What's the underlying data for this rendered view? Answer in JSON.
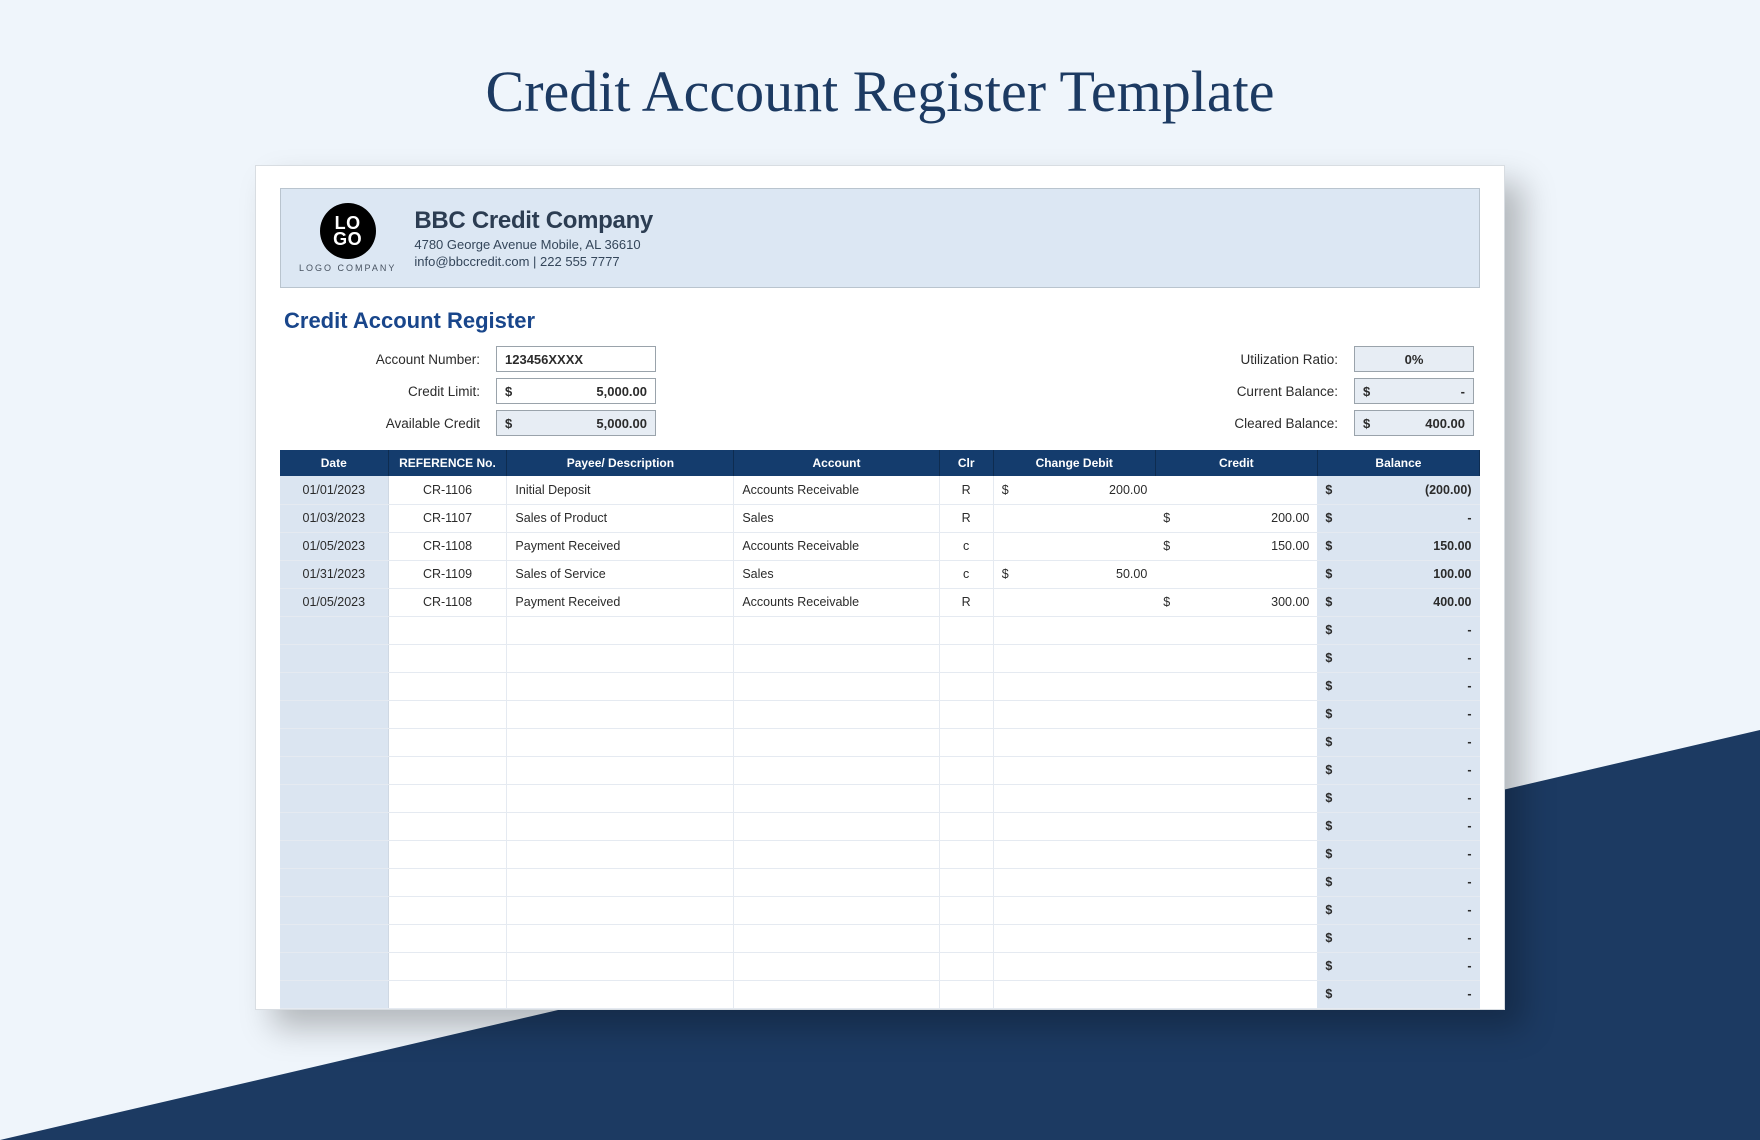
{
  "page": {
    "title": "Credit Account Register Template"
  },
  "logo": {
    "line1": "LO",
    "line2": "GO",
    "caption": "LOGO COMPANY"
  },
  "company": {
    "name": "BBC Credit Company",
    "address": "4780 George Avenue Mobile, AL 36610",
    "contact": "info@bbccredit.com | 222 555 7777"
  },
  "section_title": "Credit Account Register",
  "summary": {
    "left": [
      {
        "label": "Account Number:",
        "value": "123456XXXX",
        "shade": false,
        "style": "text"
      },
      {
        "label": "Credit Limit:",
        "value": "5,000.00",
        "shade": false,
        "style": "money"
      },
      {
        "label": "Available Credit",
        "value": "5,000.00",
        "shade": true,
        "style": "money"
      }
    ],
    "right": [
      {
        "label": "Utilization Ratio:",
        "value": "0%",
        "shade": true,
        "style": "center"
      },
      {
        "label": "Current Balance:",
        "value": "-",
        "shade": true,
        "style": "money"
      },
      {
        "label": "Cleared Balance:",
        "value": "400.00",
        "shade": true,
        "style": "money"
      }
    ]
  },
  "table": {
    "headers": [
      "Date",
      "REFERENCE No.",
      "Payee/ Description",
      "Account",
      "Clr",
      "Change Debit",
      "Credit",
      "Balance"
    ],
    "rows": [
      {
        "date": "01/01/2023",
        "ref": "CR-1106",
        "desc": "Initial Deposit",
        "acct": "Accounts Receivable",
        "clr": "R",
        "debit": "200.00",
        "credit": "",
        "balance": "(200.00)"
      },
      {
        "date": "01/03/2023",
        "ref": "CR-1107",
        "desc": "Sales of Product",
        "acct": "Sales",
        "clr": "R",
        "debit": "",
        "credit": "200.00",
        "balance": "-"
      },
      {
        "date": "01/05/2023",
        "ref": "CR-1108",
        "desc": "Payment Received",
        "acct": "Accounts Receivable",
        "clr": "c",
        "debit": "",
        "credit": "150.00",
        "balance": "150.00"
      },
      {
        "date": "01/31/2023",
        "ref": "CR-1109",
        "desc": "Sales of Service",
        "acct": "Sales",
        "clr": "c",
        "debit": "50.00",
        "credit": "",
        "balance": "100.00"
      },
      {
        "date": "01/05/2023",
        "ref": "CR-1108",
        "desc": "Payment Received",
        "acct": "Accounts Receivable",
        "clr": "R",
        "debit": "",
        "credit": "300.00",
        "balance": "400.00"
      },
      {
        "date": "",
        "ref": "",
        "desc": "",
        "acct": "",
        "clr": "",
        "debit": "",
        "credit": "",
        "balance": "-"
      },
      {
        "date": "",
        "ref": "",
        "desc": "",
        "acct": "",
        "clr": "",
        "debit": "",
        "credit": "",
        "balance": "-"
      },
      {
        "date": "",
        "ref": "",
        "desc": "",
        "acct": "",
        "clr": "",
        "debit": "",
        "credit": "",
        "balance": "-"
      },
      {
        "date": "",
        "ref": "",
        "desc": "",
        "acct": "",
        "clr": "",
        "debit": "",
        "credit": "",
        "balance": "-"
      },
      {
        "date": "",
        "ref": "",
        "desc": "",
        "acct": "",
        "clr": "",
        "debit": "",
        "credit": "",
        "balance": "-"
      },
      {
        "date": "",
        "ref": "",
        "desc": "",
        "acct": "",
        "clr": "",
        "debit": "",
        "credit": "",
        "balance": "-"
      },
      {
        "date": "",
        "ref": "",
        "desc": "",
        "acct": "",
        "clr": "",
        "debit": "",
        "credit": "",
        "balance": "-"
      },
      {
        "date": "",
        "ref": "",
        "desc": "",
        "acct": "",
        "clr": "",
        "debit": "",
        "credit": "",
        "balance": "-"
      },
      {
        "date": "",
        "ref": "",
        "desc": "",
        "acct": "",
        "clr": "",
        "debit": "",
        "credit": "",
        "balance": "-"
      },
      {
        "date": "",
        "ref": "",
        "desc": "",
        "acct": "",
        "clr": "",
        "debit": "",
        "credit": "",
        "balance": "-"
      },
      {
        "date": "",
        "ref": "",
        "desc": "",
        "acct": "",
        "clr": "",
        "debit": "",
        "credit": "",
        "balance": "-"
      },
      {
        "date": "",
        "ref": "",
        "desc": "",
        "acct": "",
        "clr": "",
        "debit": "",
        "credit": "",
        "balance": "-"
      },
      {
        "date": "",
        "ref": "",
        "desc": "",
        "acct": "",
        "clr": "",
        "debit": "",
        "credit": "",
        "balance": "-"
      },
      {
        "date": "",
        "ref": "",
        "desc": "",
        "acct": "",
        "clr": "",
        "debit": "",
        "credit": "",
        "balance": "-"
      }
    ]
  }
}
